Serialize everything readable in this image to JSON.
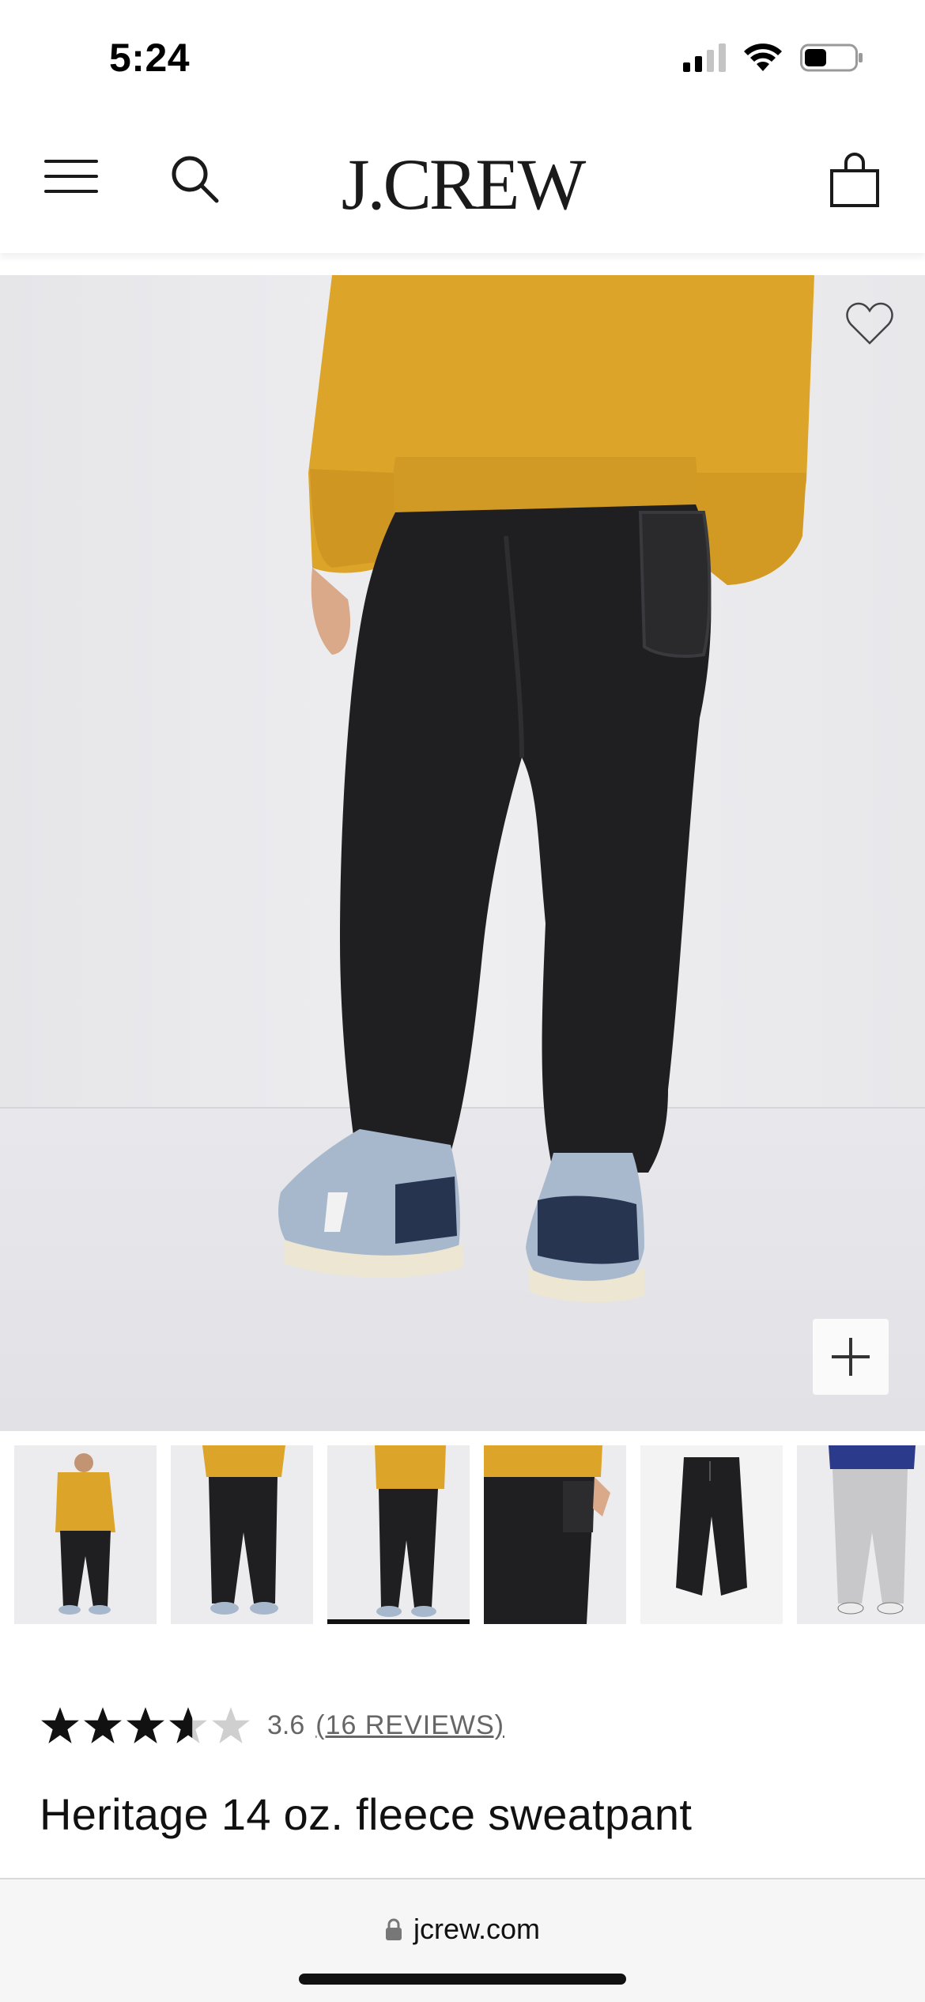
{
  "status_bar": {
    "time": "5:24",
    "battery_level_fraction": 0.45
  },
  "header": {
    "brand": "J.CREW"
  },
  "product": {
    "rating_value": "3.6",
    "rating_stars": 3.6,
    "reviews_link": "(16 REVIEWS)",
    "title": "Heritage 14 oz. fleece sweatpant",
    "thumbnails_count": 6,
    "selected_thumbnail_index": 2
  },
  "browser": {
    "url": "jcrew.com"
  },
  "icons": {
    "menu": "hamburger-icon",
    "search": "search-icon",
    "bag": "shopping-bag-icon",
    "wishlist": "heart-icon",
    "zoom": "plus-icon",
    "lock": "lock-icon"
  },
  "colors": {
    "sweatshirt": "#e0aa2a",
    "pants": "#1f1f21",
    "background": "#ebebee",
    "sneaker": "#a8b8cc"
  }
}
